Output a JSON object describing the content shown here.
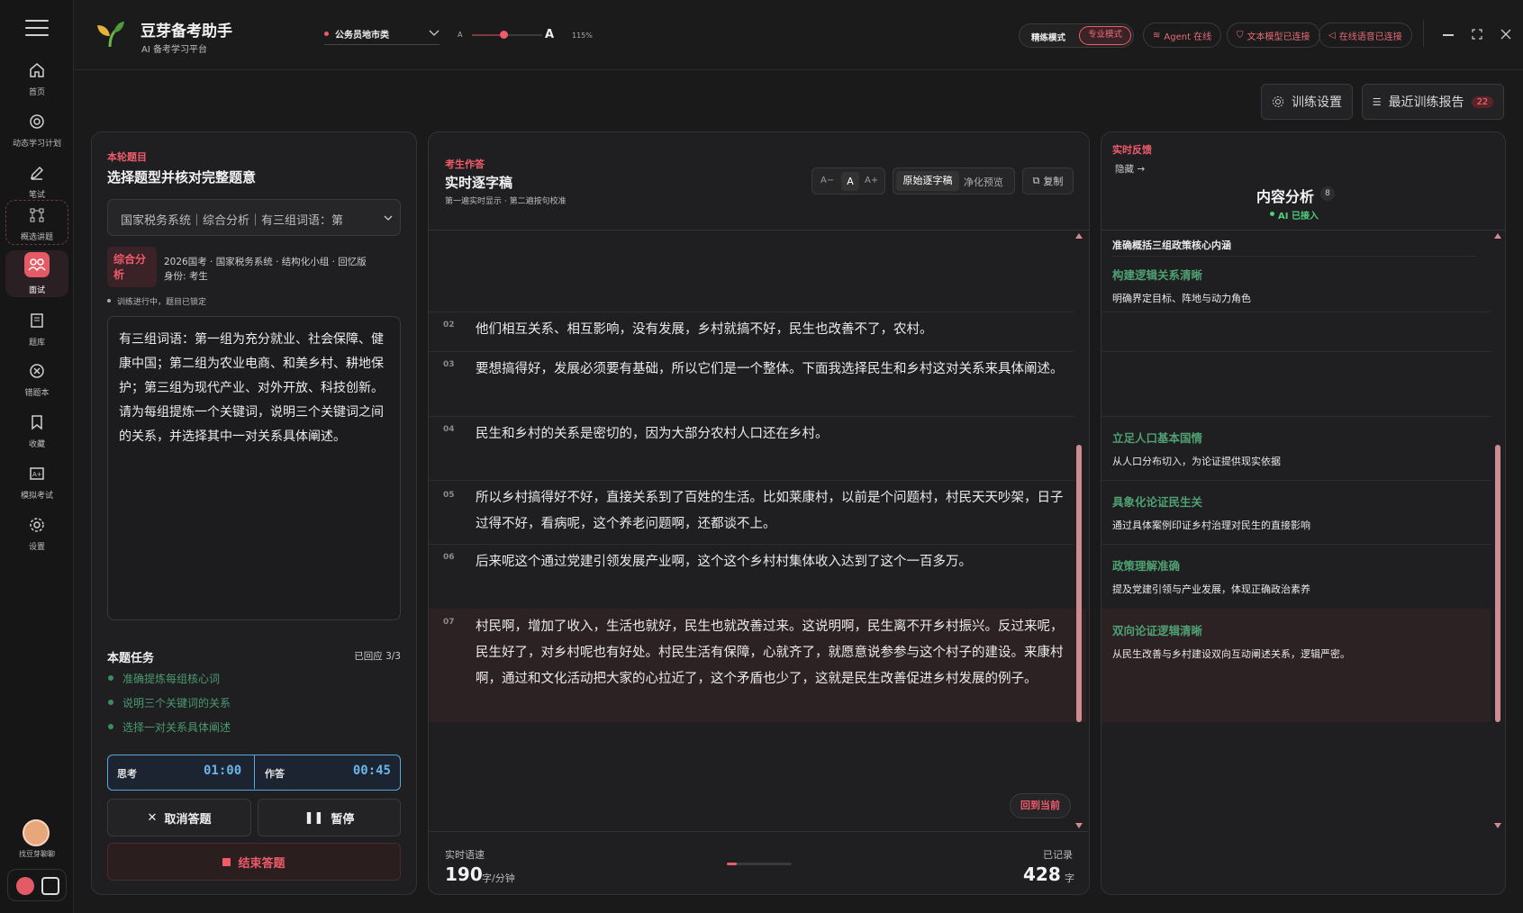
{
  "app": {
    "title": "豆芽备考助手",
    "subtitle": "AI 备考学习平台"
  },
  "sidebar": {
    "items": [
      {
        "label": "首页",
        "icon": "home-icon"
      },
      {
        "label": "动态学习计划",
        "icon": "target-icon"
      },
      {
        "label": "笔试",
        "icon": "pen-icon"
      },
      {
        "label": "概选讲题",
        "icon": "nodes-icon"
      },
      {
        "label": "面试",
        "icon": "people-icon"
      },
      {
        "label": "题库",
        "icon": "book-icon"
      },
      {
        "label": "错题本",
        "icon": "close-circle-icon"
      },
      {
        "label": "收藏",
        "icon": "bookmark-icon"
      },
      {
        "label": "模拟考试",
        "icon": "exam-icon"
      },
      {
        "label": "设置",
        "icon": "gear-icon"
      }
    ],
    "avatar_label": "找豆芽聊聊"
  },
  "header": {
    "exam_select": "公务员地市类",
    "font_small": "A",
    "font_large": "A",
    "zoom": "115%",
    "zoom_level": 0.45,
    "mode_a": "精练模式",
    "mode_b": "专业模式",
    "status": [
      "Agent 在线",
      "文本模型已连接",
      "在线语音已连接"
    ]
  },
  "toolbar": {
    "settings": "训练设置",
    "report": "最近训练报告",
    "report_count": "22"
  },
  "question": {
    "tag": "本轮题目",
    "title": "选择题型并核对完整题意",
    "select_value": "国家税务系统｜综合分析｜有三组词语：第",
    "type_badge": "综合分析",
    "meta": "2026国考 · 国家税务系统 · 结构化小组 · 回忆版",
    "identity": "身份: 考生",
    "status": "训练进行中，题目已锁定",
    "text": "有三组词语：第一组为充分就业、社会保障、健康中国；第二组为农业电商、和美乡村、耕地保护；第三组为现代产业、对外开放、科技创新。请为每组提炼一个关键词，说明三个关键词之间的关系，并选择其中一对关系具体阐述。",
    "task_title": "本题任务",
    "task_done": "已回应 3/3",
    "tasks": [
      "准确提炼每组核心词",
      "说明三个关键词的关系",
      "选择一对关系具体阐述"
    ],
    "think_label": "思考",
    "think_time": "01:00",
    "answer_label": "作答",
    "answer_time": "00:45",
    "cancel": "取消答题",
    "pause": "暂停",
    "end": "结束答题"
  },
  "transcript": {
    "tag": "考生作答",
    "title": "实时逐字稿",
    "sub": "第一遍实时显示 · 第二遍按句校准",
    "font_minus": "A−",
    "font_mid": "A",
    "font_plus": "A+",
    "view_raw": "原始逐字稿",
    "view_clean": "净化预览",
    "copy": "复制",
    "rows": [
      {
        "n": "02",
        "t": "他们相互关系、相互影响，没有发展，乡村就搞不好，民生也改善不了，农村。"
      },
      {
        "n": "03",
        "t": "要想搞得好，发展必须要有基础，所以它们是一个整体。下面我选择民生和乡村这对关系来具体阐述。"
      },
      {
        "n": "04",
        "t": "民生和乡村的关系是密切的，因为大部分农村人口还在乡村。"
      },
      {
        "n": "05",
        "t": "所以乡村搞得好不好，直接关系到了百姓的生活。比如莱康村，以前是个问题村，村民天天吵架，日子过得不好，看病呢，这个养老问题啊，还都谈不上。"
      },
      {
        "n": "06",
        "t": "后来呢这个通过党建引领发展产业啊，这个这个乡村村集体收入达到了这个一百多万。"
      },
      {
        "n": "07",
        "t": "村民啊，增加了收入，生活也就好，民生也就改善过来。这说明啊，民生离不开乡村振兴。反过来呢，民生好了，对乡村呢也有好处。村民生活有保障，心就齐了，就愿意说参参与这个村子的建设。来康村啊，通过和文化活动把大家的心拉近了，这个矛盾也少了，这就是民生改善促进乡村发展的例子。"
      }
    ],
    "back": "回到当前",
    "speed_label": "实时语速",
    "speed": "190",
    "speed_unit": "字/分钟",
    "rec_label": "已记录",
    "rec": "428",
    "rec_unit": "字"
  },
  "feedback": {
    "tag": "实时反馈",
    "hide": "隐藏 →",
    "title": "内容分析",
    "count": "8",
    "ai": "AI 已接入",
    "top_line": "准确概括三组政策核心内涵",
    "items": [
      {
        "t": "构建逻辑关系清晰",
        "d": "明确界定目标、阵地与动力角色"
      },
      {
        "t": "立足人口基本国情",
        "d": "从人口分布切入，为论证提供现实依据"
      },
      {
        "t": "具象化论证民生关",
        "d": "通过具体案例印证乡村治理对民生的直接影响"
      },
      {
        "t": "政策理解准确",
        "d": "提及党建引领与产业发展，体现正确政治素养"
      },
      {
        "t": "双向论证逻辑清晰",
        "d": "从民生改善与乡村建设双向互动阐述关系，逻辑严密。"
      }
    ]
  },
  "colors": {
    "accent": "#ef5b6b",
    "green": "#4fa072",
    "blue": "#5aa7d9"
  }
}
